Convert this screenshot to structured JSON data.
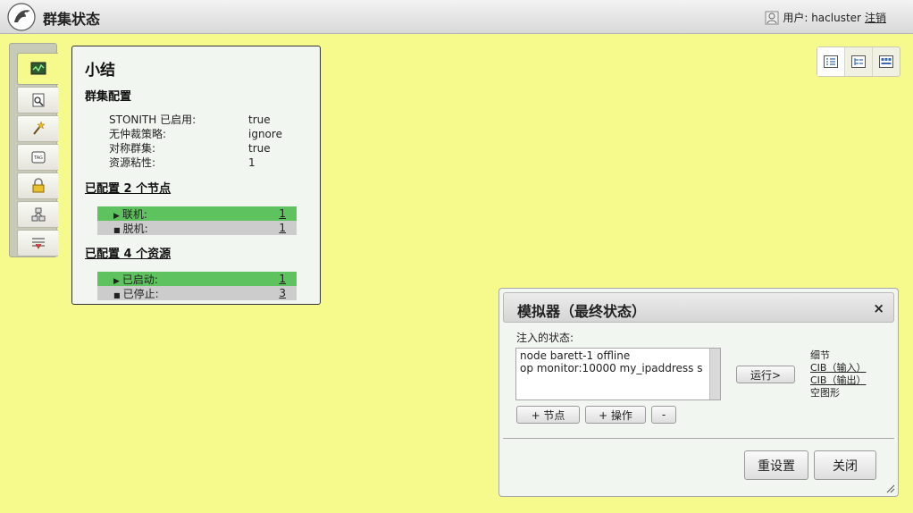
{
  "header": {
    "title": "群集状态",
    "user_label": "用户: hacluster",
    "logout_label": "注销"
  },
  "toolbar": {
    "items": [
      {
        "icon": "monitor-icon",
        "active": true
      },
      {
        "icon": "magnifier-document-icon"
      },
      {
        "icon": "wand-icon"
      },
      {
        "icon": "tag-icon"
      },
      {
        "icon": "lock-icon"
      },
      {
        "icon": "nodes-icon"
      },
      {
        "icon": "history-icon"
      }
    ]
  },
  "summary": {
    "title": "小结",
    "config_heading": "群集配置",
    "config": [
      {
        "key": "STONITH 已启用:",
        "value": "true"
      },
      {
        "key": "无仲裁策略:",
        "value": "ignore"
      },
      {
        "key": "对称群集:",
        "value": "true"
      },
      {
        "key": "资源粘性:",
        "value": "1"
      }
    ],
    "nodes_heading": "已配置 2 个节点",
    "nodes": [
      {
        "label": "联机:",
        "count": "1",
        "state": "green"
      },
      {
        "label": "脱机:",
        "count": "1",
        "state": "grey"
      }
    ],
    "resources_heading": "已配置 4 个资源",
    "resources": [
      {
        "label": "已启动:",
        "count": "1",
        "state": "green"
      },
      {
        "label": "已停止:",
        "count": "3",
        "state": "grey"
      }
    ]
  },
  "simulator": {
    "title": "模拟器（最终状态）",
    "close_glyph": "×",
    "inject_label": "注入的状态:",
    "inject_lines": [
      "node barett-1 offline",
      "op monitor:10000 my_ipaddress s"
    ],
    "run_label": "运行>",
    "add_node_label": "+ 节点",
    "add_op_label": "+ 操作",
    "remove_label": "-",
    "details_label": "细节",
    "cib_in_label": "CIB（输入）",
    "cib_out_label": "CIB（输出）",
    "graph_label": "空图形",
    "reset_label": "重设置",
    "close_label": "关闭"
  },
  "colors": {
    "background": "#f6f98b",
    "online": "#5ec25e",
    "offline": "#cccccc"
  }
}
